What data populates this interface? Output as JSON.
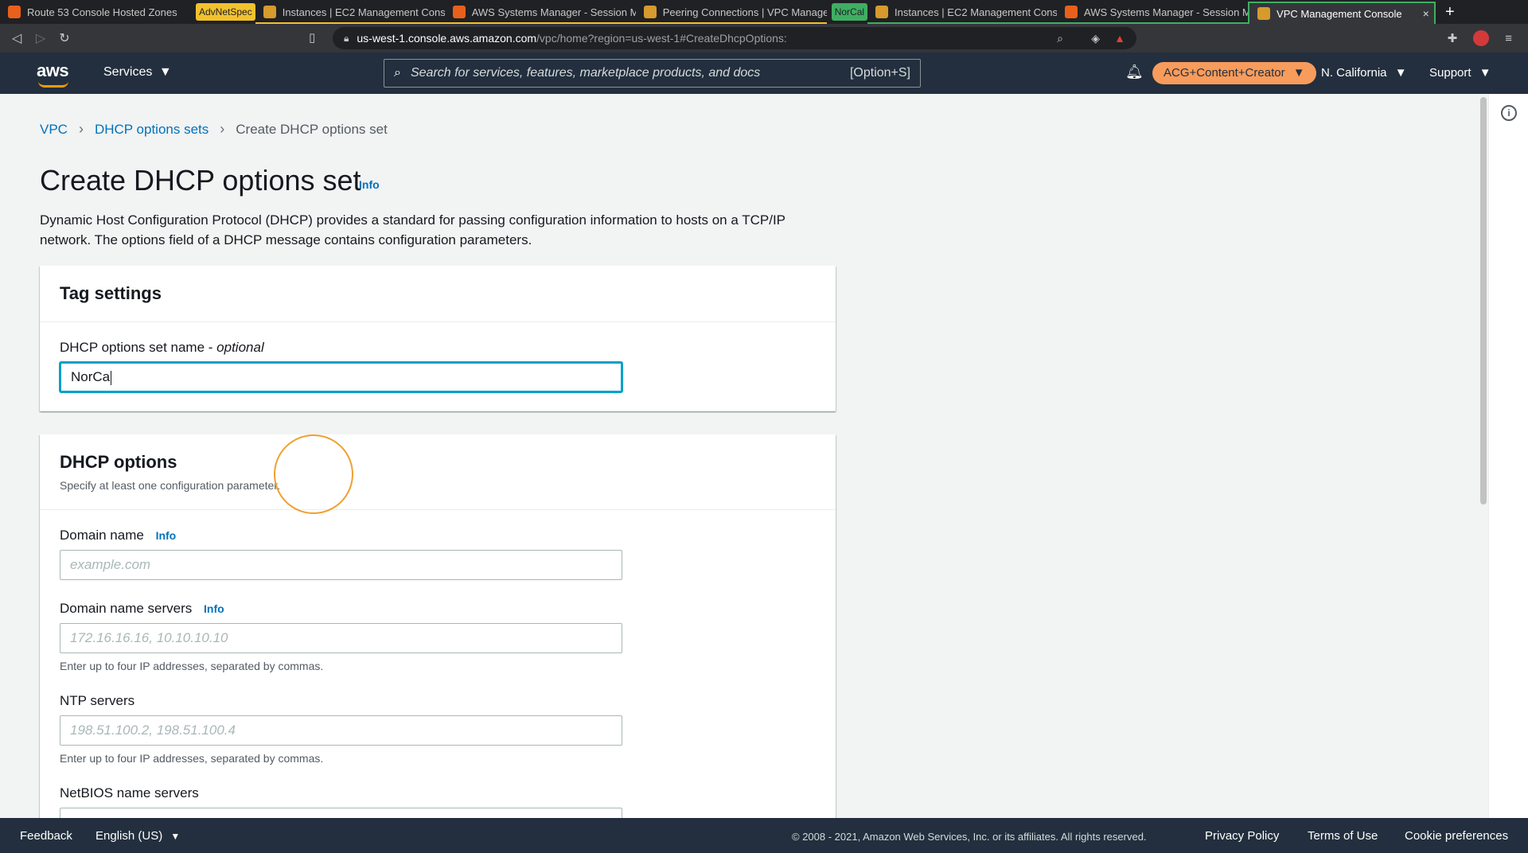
{
  "browser": {
    "tabs": [
      {
        "label": "Route 53 Console Hosted Zones",
        "favicon": "aws-cube-icon"
      },
      {
        "group": "AdvNetSpec",
        "label": "Instances | EC2 Management Cons",
        "favicon": "ec2-icon"
      },
      {
        "label": "AWS Systems Manager - Session M",
        "favicon": "aws-cube-icon"
      },
      {
        "label": "Peering Connections | VPC Manage",
        "favicon": "vpc-icon"
      },
      {
        "group": "NorCal",
        "label": "Instances | EC2 Management Cons",
        "favicon": "ec2-icon"
      },
      {
        "label": "AWS Systems Manager - Session M",
        "favicon": "aws-cube-icon"
      },
      {
        "label": "VPC Management Console",
        "favicon": "vpc-icon",
        "active": true
      }
    ],
    "new_tab": "+",
    "close": "×",
    "url_host": "us-west-1.console.aws.amazon.com",
    "url_path": "/vpc/home?region=us-west-1#CreateDhcpOptions:"
  },
  "aws_nav": {
    "logo": "aws",
    "services": "Services",
    "search_placeholder": "Search for services, features, marketplace products, and docs",
    "search_shortcut": "[Option+S]",
    "account": "ACG+Content+Creator",
    "region": "N. California",
    "support": "Support"
  },
  "breadcrumb": {
    "items": [
      "VPC",
      "DHCP options sets"
    ],
    "current": "Create DHCP options set"
  },
  "page": {
    "title": "Create DHCP options set",
    "info": "Info",
    "description": "Dynamic Host Configuration Protocol (DHCP) provides a standard for passing configuration information to hosts on a TCP/IP network. The options field of a DHCP message contains configuration parameters."
  },
  "tag_settings": {
    "heading": "Tag settings",
    "name_label": "DHCP options set name -",
    "name_optional": "optional",
    "name_value": "NorCa"
  },
  "dhcp_options": {
    "heading": "DHCP options",
    "subheading": "Specify at least one configuration parameter.",
    "domain_name": {
      "label": "Domain name",
      "info": "Info",
      "placeholder": "example.com"
    },
    "domain_name_servers": {
      "label": "Domain name servers",
      "info": "Info",
      "placeholder": "172.16.16.16, 10.10.10.10",
      "hint": "Enter up to four IP addresses, separated by commas."
    },
    "ntp_servers": {
      "label": "NTP servers",
      "placeholder": "198.51.100.2, 198.51.100.4",
      "hint": "Enter up to four IP addresses, separated by commas."
    },
    "netbios_name_servers": {
      "label": "NetBIOS name servers"
    }
  },
  "footer": {
    "feedback": "Feedback",
    "language": "English (US)",
    "copyright": "© 2008 - 2021, Amazon Web Services, Inc. or its affiliates. All rights reserved.",
    "privacy": "Privacy Policy",
    "terms": "Terms of Use",
    "cookies": "Cookie preferences"
  },
  "colors": {
    "aws_nav_bg": "#232f3e",
    "link": "#0073bb",
    "focus": "#00a1c9",
    "account_pill": "#f89c5c"
  }
}
